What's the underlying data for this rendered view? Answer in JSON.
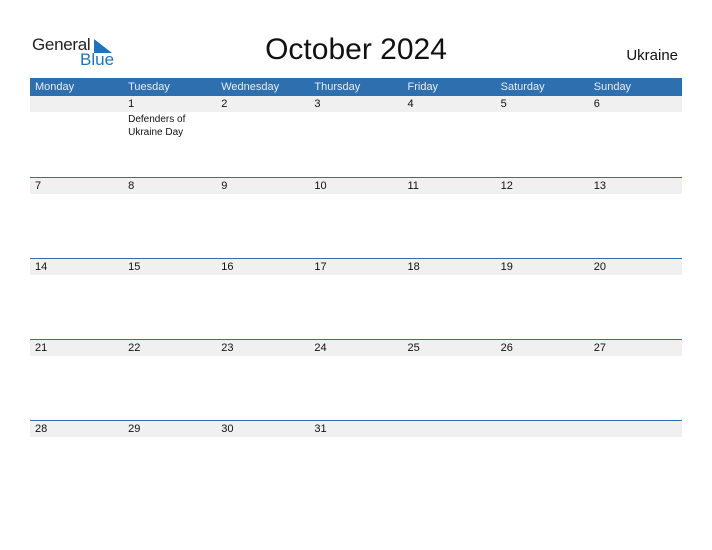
{
  "logo": {
    "part1": "General",
    "part2": "Blue"
  },
  "title": "October 2024",
  "country": "Ukraine",
  "weekdays": [
    "Monday",
    "Tuesday",
    "Wednesday",
    "Thursday",
    "Friday",
    "Saturday",
    "Sunday"
  ],
  "weeks": [
    {
      "days": [
        "",
        "1",
        "2",
        "3",
        "4",
        "5",
        "6"
      ],
      "holidays": [
        "",
        "Defenders of Ukraine Day",
        "",
        "",
        "",
        "",
        ""
      ]
    },
    {
      "days": [
        "7",
        "8",
        "9",
        "10",
        "11",
        "12",
        "13"
      ],
      "holidays": [
        "",
        "",
        "",
        "",
        "",
        "",
        ""
      ]
    },
    {
      "days": [
        "14",
        "15",
        "16",
        "17",
        "18",
        "19",
        "20"
      ],
      "holidays": [
        "",
        "",
        "",
        "",
        "",
        "",
        ""
      ]
    },
    {
      "days": [
        "21",
        "22",
        "23",
        "24",
        "25",
        "26",
        "27"
      ],
      "holidays": [
        "",
        "",
        "",
        "",
        "",
        "",
        ""
      ]
    },
    {
      "days": [
        "28",
        "29",
        "30",
        "31",
        "",
        "",
        ""
      ],
      "holidays": [
        "",
        "",
        "",
        "",
        "",
        "",
        ""
      ]
    }
  ],
  "colors": {
    "accent": "#2e6fb0",
    "brand_blue": "#1e73be",
    "row_bg": "#f0f0f0"
  }
}
